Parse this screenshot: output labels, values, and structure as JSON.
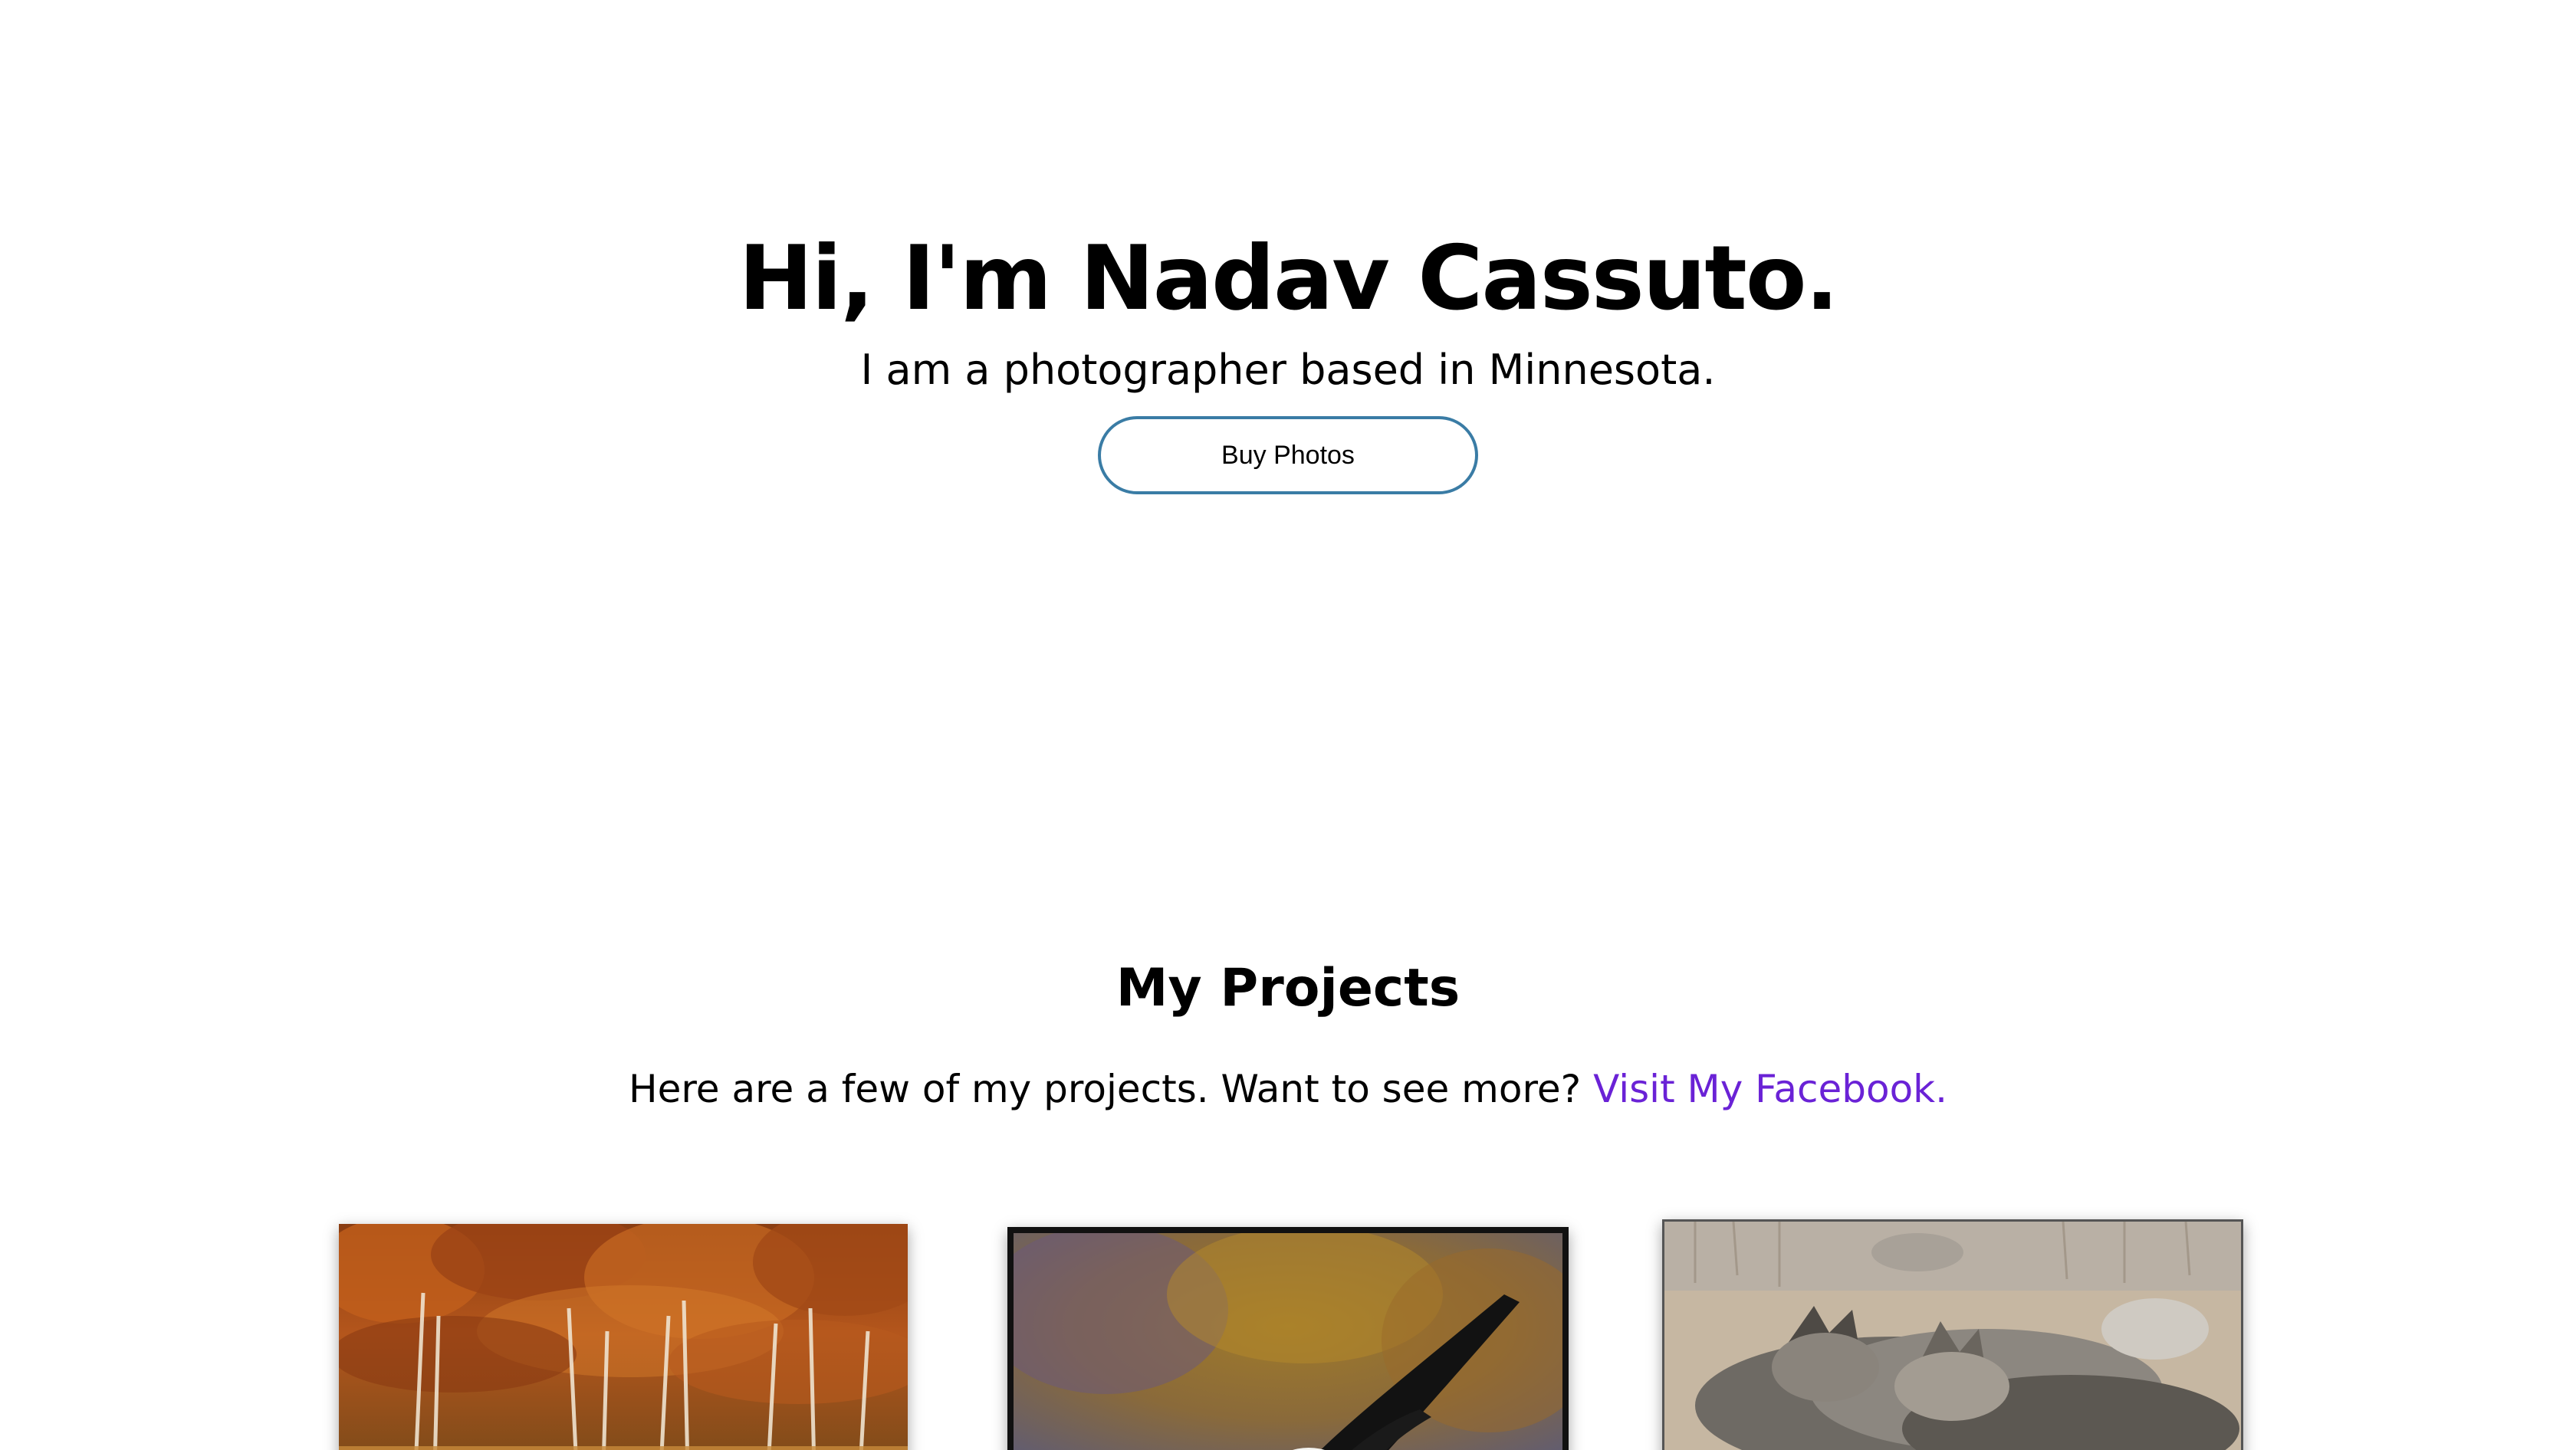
{
  "hero": {
    "title": "Hi, I'm Nadav Cassuto.",
    "subtitle": "I am a photographer based in Minnesota.",
    "button_label": "Buy Photos"
  },
  "projects": {
    "heading": "My Projects",
    "intro_text": "Here are a few of my projects. Want to see more?",
    "link_text": "Visit My Facebook.",
    "cards": [
      {
        "name": "autumn-forest-photo"
      },
      {
        "name": "bald-eagle-photo"
      },
      {
        "name": "wolves-photo"
      }
    ]
  },
  "colors": {
    "button_border": "#3a7ca5",
    "link": "#6a22d6",
    "background": "#ffffff"
  }
}
